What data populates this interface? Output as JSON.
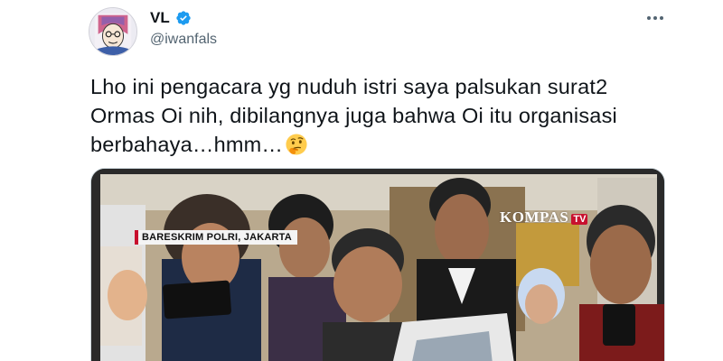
{
  "author": {
    "display_name": "VL",
    "handle": "@iwanfals",
    "verified_icon": "verified-badge-icon",
    "verified_color": "#1d9bf0"
  },
  "tweet": {
    "line1": "Lho ini pengacara yg nuduh istri saya palsukan surat2",
    "line2": "Ormas Oi nih, dibilangnya juga bahwa Oi itu organisasi",
    "line3": "berbahaya…hmm…",
    "emoji": "thinking-face-emoji"
  },
  "media": {
    "location_caption": "BARESKRIM POLRI, JAKARTA",
    "channel_logo": "KOMPAS",
    "channel_logo_suffix": "TV"
  },
  "menu": {
    "more_icon": "more-options-icon"
  }
}
